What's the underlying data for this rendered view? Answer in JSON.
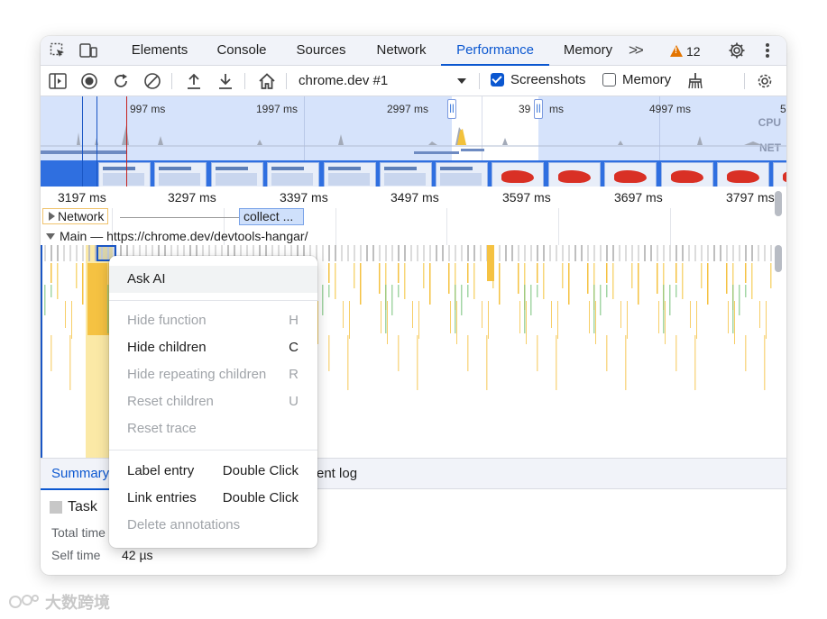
{
  "tabbar": {
    "tabs": [
      {
        "label": "Elements",
        "active": false
      },
      {
        "label": "Console",
        "active": false
      },
      {
        "label": "Sources",
        "active": false
      },
      {
        "label": "Network",
        "active": false
      },
      {
        "label": "Performance",
        "active": true
      },
      {
        "label": "Memory",
        "active": false
      }
    ],
    "more_label": ">>",
    "warning_count": "12",
    "icons": [
      "inspect-element-icon",
      "device-toolbar-icon",
      "settings-gear-icon",
      "more-vertical-icon"
    ]
  },
  "toolbar": {
    "target": "chrome.dev #1",
    "screenshots_label": "Screenshots",
    "screenshots_checked": true,
    "memory_label": "Memory",
    "memory_checked": false,
    "icons": [
      "toggle-sidebar-icon",
      "record-icon",
      "reload-record-icon",
      "clear-icon",
      "upload-profile-icon",
      "download-profile-icon",
      "home-icon",
      "garbage-collect-icon",
      "capture-settings-icon"
    ]
  },
  "overview": {
    "ticks": [
      "997 ms",
      "1997 ms",
      "2997 ms",
      "39",
      "ms",
      "4997 ms",
      "5"
    ],
    "cpu_label": "CPU",
    "net_label": "NET"
  },
  "ruler": {
    "ticks": [
      "3197 ms",
      "3297 ms",
      "3397 ms",
      "3497 ms",
      "3597 ms",
      "3697 ms",
      "3797 ms"
    ]
  },
  "tracks": {
    "network_label": "Network",
    "network_chip": "collect ...",
    "main_label": "Main — https://chrome.dev/devtools-hangar/"
  },
  "context_menu": {
    "items": [
      {
        "label": "Ask AI",
        "shortcut": "",
        "disabled": false,
        "highlighted": true
      },
      {
        "label": "Hide function",
        "shortcut": "H",
        "disabled": true
      },
      {
        "label": "Hide children",
        "shortcut": "C",
        "disabled": false
      },
      {
        "label": "Hide repeating children",
        "shortcut": "R",
        "disabled": true
      },
      {
        "label": "Reset children",
        "shortcut": "U",
        "disabled": true
      },
      {
        "label": "Reset trace",
        "shortcut": "",
        "disabled": true
      },
      {
        "label": "Label entry",
        "shortcut": "Double Click",
        "disabled": false
      },
      {
        "label": "Link entries",
        "shortcut": "Double Click",
        "disabled": false
      },
      {
        "label": "Delete annotations",
        "shortcut": "",
        "disabled": true
      }
    ]
  },
  "bottom": {
    "tab_summary": "Summary",
    "tab_eventlog": "ent log",
    "task_label": "Task",
    "total_time_label": "Total time",
    "self_time_label": "Self time",
    "self_time_value": "42 µs"
  },
  "watermark": {
    "text": "大数跨境"
  },
  "colors": {
    "accent": "#0b57d0",
    "overview_bg": "#d6e3fb",
    "warning": "#e37400",
    "flame_yellow": "#f5c242",
    "flame_green": "#7cc47f"
  }
}
